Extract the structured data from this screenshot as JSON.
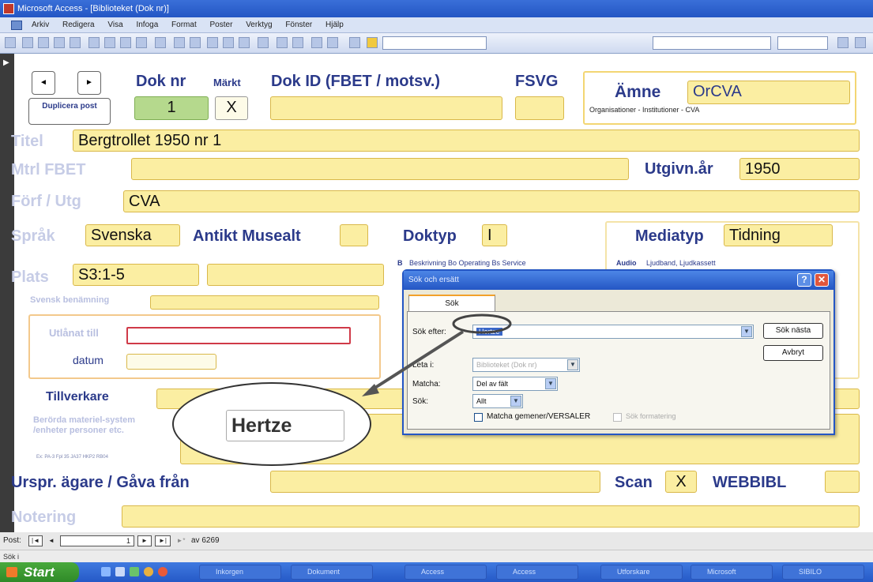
{
  "window": {
    "title": "Microsoft Access - [Biblioteket (Dok nr)]"
  },
  "menu": [
    "Arkiv",
    "Redigera",
    "Visa",
    "Infoga",
    "Format",
    "Poster",
    "Verktyg",
    "Fönster",
    "Hjälp"
  ],
  "form": {
    "nav_prev": "◄",
    "nav_next": "►",
    "duplicate_label": "Duplicera post",
    "doknr_label": "Dok nr",
    "doknr_value": "1",
    "markt_label": "Märkt",
    "markt_value": "X",
    "dokid_label": "Dok ID (FBET / motsv.)",
    "dokid_value": "",
    "fsvg_label": "FSVG",
    "fsvg_value": "",
    "amne_label": "Ämne",
    "amne_value": "OrCVA",
    "amne_desc": "Organisationer - Institutioner - CVA",
    "titel_label": "Titel",
    "titel_value": "Bergtrollet 1950 nr 1",
    "mtrl_label": "Mtrl FBET",
    "mtrl_value": "",
    "utgivn_label": "Utgivn.år",
    "utgivn_value": "1950",
    "forf_label": "Förf / Utg",
    "forf_value": "CVA",
    "sprak_label": "Språk",
    "sprak_value": "Svenska",
    "antikt_label": "Antikt Musealt",
    "antikt_value": "",
    "doktyp_label": "Doktyp",
    "doktyp_value": "I",
    "doktyp_desc_code": "B",
    "doktyp_desc": "Beskrivning  Bo Operating  Bs Service",
    "mediatyp_label": "Mediatyp",
    "mediatyp_value": "Tidning",
    "mediatyp_desc_code": "Audio",
    "mediatyp_desc": "Ljudband, Ljudkassett",
    "plats_label": "Plats",
    "plats_value": "S3:1-5",
    "svensk_label": "Svensk benämning",
    "utlanat_label": "Utlånat till",
    "datum_label": "datum",
    "tillverkare_label": "Tillverkare",
    "berorda_label": "Berörda materiel-system /enheter personer etc.",
    "berorda_sub": "Ex: PA-3 Fpl 35 JA37 HKP2 RB04",
    "urspr_label": "Urspr. ägare / Gåva från",
    "scan_label": "Scan",
    "scan_value": "X",
    "webbibl_label": "WEBBIBL",
    "notering_label": "Notering"
  },
  "record_nav": {
    "post_label": "Post:",
    "current": "1",
    "of_label": "av 6269"
  },
  "status": "Sök i",
  "dialog": {
    "title": "Sök och ersätt",
    "help_btn": "?",
    "close_btn": "✕",
    "tab": "Sök",
    "sok_efter_label": "Sök efter:",
    "sok_efter_value": "Hertze",
    "leta_label": "Leta i:",
    "leta_value": "Biblioteket (Dok nr)",
    "matcha_label": "Matcha:",
    "matcha_value": "Del av fält",
    "sok_label": "Sök:",
    "sok_value": "Allt",
    "match_case_label": "Matcha gemener/VERSALER",
    "format_label": "Sök formatering",
    "find_next": "Sök nästa",
    "cancel": "Avbryt"
  },
  "callout": {
    "text": "Hertze"
  },
  "taskbar": {
    "start": "Start",
    "tasks": [
      "Inkorgen",
      "Dokument",
      "Access",
      "Access",
      "Utforskare",
      "Microsoft",
      "SIBILO"
    ]
  }
}
